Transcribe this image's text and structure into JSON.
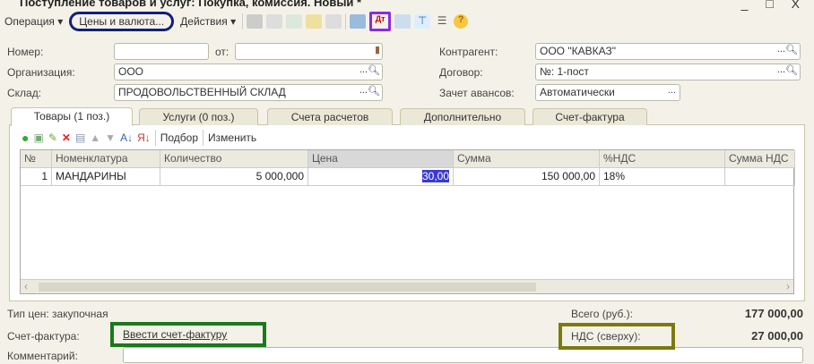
{
  "window": {
    "title": "Поступление товаров и услуг: Покупка, комиссия. Новый *",
    "controls": "_ □ X"
  },
  "toolbar": {
    "operation": "Операция ▾",
    "prices": "Цены и валюта...",
    "actions": "Действия ▾",
    "help": "?"
  },
  "form": {
    "number_label": "Номер:",
    "number_value": "",
    "from_label": "от:",
    "from_value": "",
    "org_label": "Организация:",
    "org_value": "ООО",
    "warehouse_label": "Склад:",
    "warehouse_value": "ПРОДОВОЛЬСТВЕННЫЙ СКЛАД",
    "counterparty_label": "Контрагент:",
    "counterparty_value": "ООО \"КАВКАЗ\"",
    "contract_label": "Договор:",
    "contract_value": "№: 1-пост",
    "advance_label": "Зачет авансов:",
    "advance_value": "Автоматически"
  },
  "tabs": [
    "Товары (1 поз.)",
    "Услуги (0 поз.)",
    "Счета расчетов",
    "Дополнительно",
    "Счет-фактура"
  ],
  "grid_toolbar": {
    "pick": "Подбор",
    "change": "Изменить"
  },
  "grid": {
    "headers": [
      "№",
      "Номенклатура",
      "Количество",
      "Цена",
      "Сумма",
      "%НДС",
      "Сумма НДС"
    ],
    "rows": [
      [
        "1",
        "МАНДАРИНЫ",
        "5 000,000",
        "30,00",
        "150 000,00",
        "18%",
        ""
      ]
    ]
  },
  "footer": {
    "price_type": "Тип цен: закупочная",
    "invoice_label": "Счет-фактура:",
    "invoice_link": "Ввести счет-фактуру",
    "total_label": "Всего (руб.):",
    "total_value": "177 000,00",
    "vat_label": "НДС (сверху):",
    "vat_value": "27 000,00",
    "comment_label": "Комментарий:",
    "comment_value": ""
  },
  "annotations": {
    "blue": "#10207a",
    "purple": "#8a2be2",
    "green": "#1a7a1a",
    "olive": "#7a7a10"
  }
}
